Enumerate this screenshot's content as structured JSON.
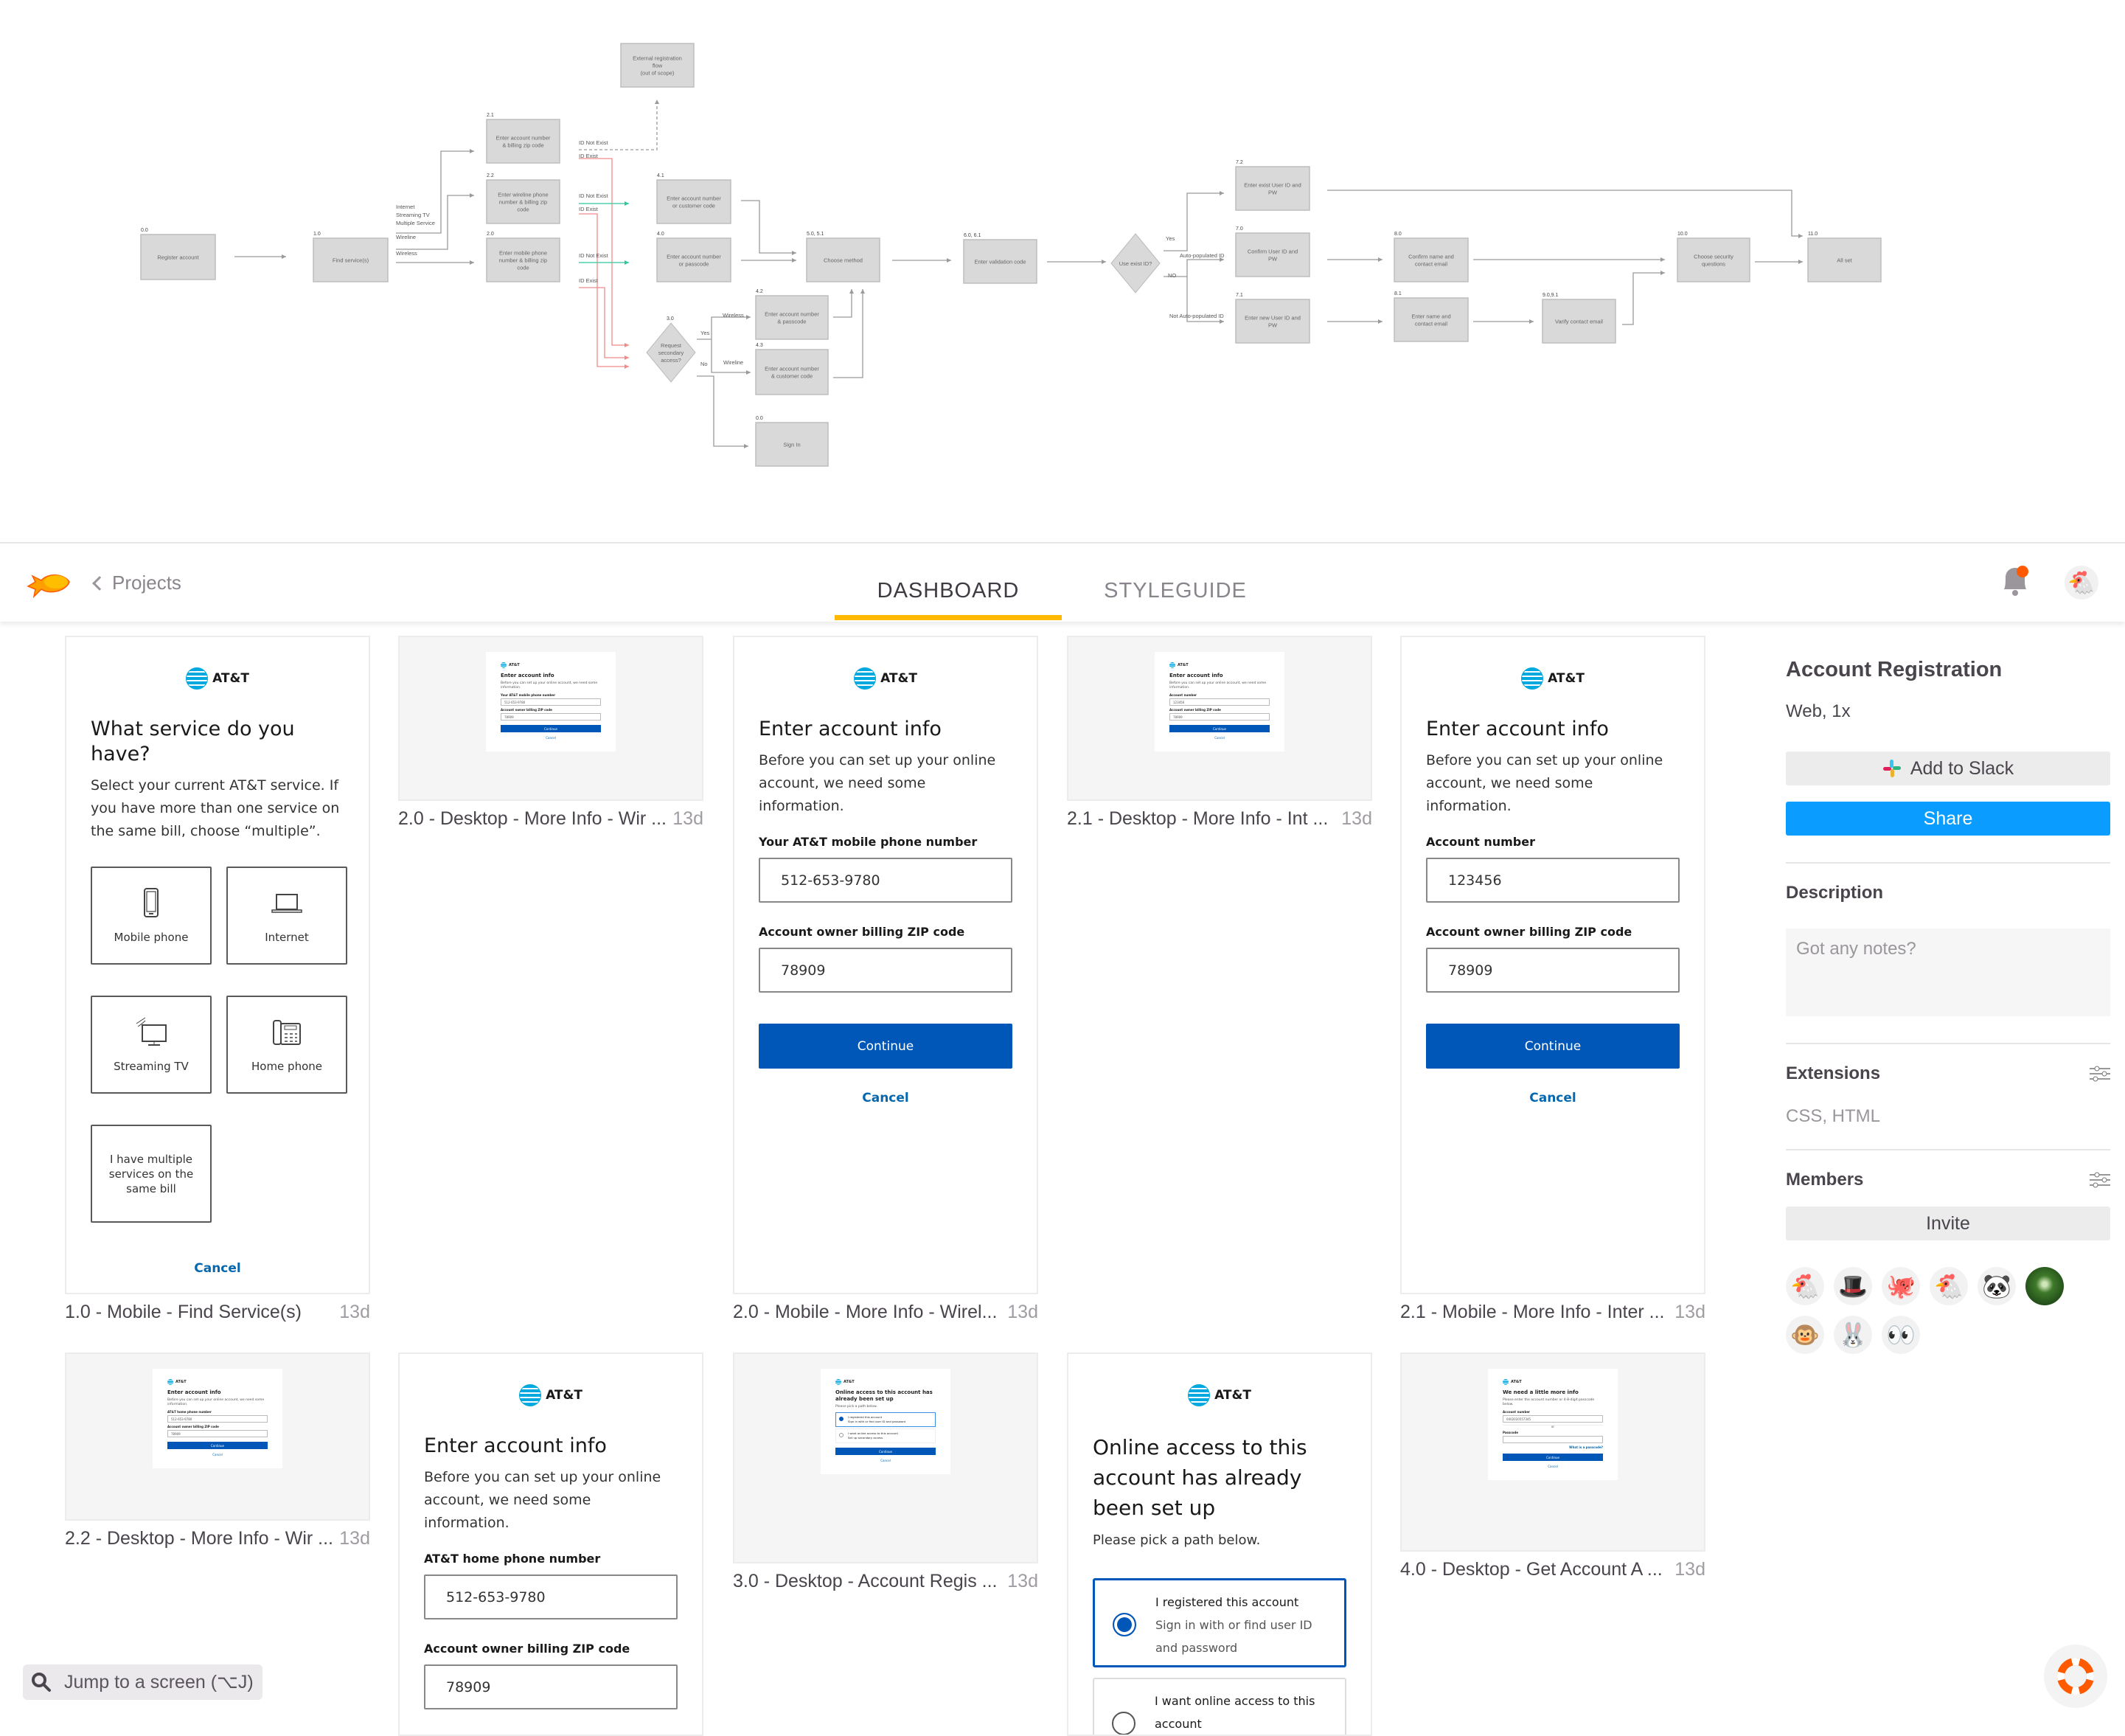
{
  "flow": {
    "nodes": [
      {
        "id": "0.0",
        "lines": [
          "Register account"
        ]
      },
      {
        "id": "1.0",
        "lines": [
          "Find service(s)"
        ]
      },
      {
        "id": "2.1",
        "lines": [
          "Enter account number",
          "& billing zip code"
        ]
      },
      {
        "id": "2.2",
        "lines": [
          "Enter wireline phone",
          "number & billing zip",
          "code"
        ]
      },
      {
        "id": "2.0",
        "lines": [
          "Enter mobile phone",
          "number & billing zip",
          "code"
        ]
      },
      {
        "id": "",
        "lines": [
          "External registration",
          "flow",
          "(out of scope)"
        ]
      },
      {
        "id": "4.1",
        "lines": [
          "Enter account number",
          "or customer code"
        ]
      },
      {
        "id": "4.0",
        "lines": [
          "Enter account number",
          "or passcode"
        ]
      },
      {
        "id": "5.0, 5.1",
        "lines": [
          "Choose method"
        ]
      },
      {
        "id": "4.2",
        "lines": [
          "Enter account number",
          "& passcode"
        ]
      },
      {
        "id": "4.3",
        "lines": [
          "Enter account number",
          "& customer code"
        ]
      },
      {
        "id": "0.0",
        "lines": [
          "Sign In"
        ]
      },
      {
        "id": "3.0",
        "lines": [
          "Request",
          "secondary",
          "access?"
        ]
      },
      {
        "id": "6.0, 6.1",
        "lines": [
          "Enter validation code"
        ]
      },
      {
        "id": "",
        "lines": [
          "Use exist ID?"
        ]
      },
      {
        "id": "7.2",
        "lines": [
          "Enter exist User ID and",
          "PW"
        ]
      },
      {
        "id": "7.0",
        "lines": [
          "Confirm User ID and",
          "PW"
        ]
      },
      {
        "id": "7.1",
        "lines": [
          "Enter new User ID and",
          "PW"
        ]
      },
      {
        "id": "8.0",
        "lines": [
          "Confirm name and",
          "contact email"
        ]
      },
      {
        "id": "8.1",
        "lines": [
          "Enter name and",
          "contact email"
        ]
      },
      {
        "id": "9.0,9.1",
        "lines": [
          "Varify contact email"
        ]
      },
      {
        "id": "10.0",
        "lines": [
          "Choose security",
          "questions"
        ]
      },
      {
        "id": "11.0",
        "lines": [
          "All set"
        ]
      }
    ],
    "edge_labels": [
      "Internet",
      "Streaming TV",
      "Multiple Service",
      "Wireline",
      "Wireless",
      "ID Not Exist",
      "ID Exist",
      "ID Not Exist",
      "ID Exist",
      "ID Not Exist",
      "ID Exist",
      "Yes",
      "No",
      "Wireless",
      "Wireline",
      "Yes",
      "Auto-populated ID",
      "NO",
      "Not Auto-populated ID"
    ],
    "colors": {
      "line": "#9a9a9a",
      "exist": "#f08a8a",
      "not_exist": "#2fc79a",
      "node": "#d9d9d9"
    }
  },
  "header": {
    "back_label": "Projects",
    "tabs": [
      {
        "label": "DASHBOARD",
        "active": true
      },
      {
        "label": "STYLEGUIDE",
        "active": false
      }
    ],
    "accent": "#ffb900",
    "user_avatar": "🐔"
  },
  "brand": "AT&T",
  "cards": {
    "find_service": {
      "title": "What service do you have?",
      "body": "Select your current AT&T service. If you have more than one service on the same bill, choose “multiple”.",
      "tiles": [
        "Mobile phone",
        "Internet",
        "Streaming TV",
        "Home phone",
        "I have multiple services on the same bill"
      ],
      "cancel": "Cancel",
      "caption": "1.0 - Mobile - Find Service(s)",
      "age": "13d"
    },
    "mobile_wireless": {
      "title": "Enter account info",
      "body": "Before you can set up your online account, we need some information.",
      "field1_label": "Your AT&T mobile phone number",
      "field1_value": "512-653-9780",
      "field2_label": "Account owner billing ZIP code",
      "field2_value": "78909",
      "continue": "Continue",
      "cancel": "Cancel",
      "caption": "2.0 - Mobile - More Info - Wirel...",
      "age": "13d"
    },
    "mobile_internet": {
      "title": "Enter account info",
      "body": "Before you can set up your online account, we need some information.",
      "field1_label": "Account number",
      "field1_value": "123456",
      "field2_label": "Account owner billing ZIP code",
      "field2_value": "78909",
      "continue": "Continue",
      "cancel": "Cancel",
      "caption": "2.1 - Mobile - More Info - Inter ...",
      "age": "13d"
    },
    "mobile_wireline": {
      "title": "Enter account info",
      "body": "Before you can set up your online account, we need some information.",
      "field1_label": "AT&T home phone number",
      "field1_value": "512-653-9780",
      "field2_label": "Account owner billing ZIP code",
      "field2_value": "78909"
    },
    "mobile_online_access": {
      "title": "Online access to this account has already been set up",
      "body": "Please pick a path below.",
      "option1_title": "I registered this account",
      "option1_sub": "Sign in with or find user ID and password",
      "option2_title": "I want online access to this account"
    }
  },
  "thumbs": [
    {
      "caption": "2.0 - Desktop - More Info - Wir ...",
      "age": "13d",
      "items": [
        {
          "t": "title",
          "text": "Enter account info"
        },
        {
          "t": "p",
          "text": "Before you can set up your online account, we need some information."
        },
        {
          "t": "label",
          "text": "Your AT&T mobile phone number"
        },
        {
          "t": "input",
          "text": "512-653-9780"
        },
        {
          "t": "label",
          "text": "Account owner billing ZIP code"
        },
        {
          "t": "input",
          "text": "78909"
        },
        {
          "t": "button",
          "text": "Continue"
        },
        {
          "t": "cancel",
          "text": "Cancel"
        }
      ]
    },
    {
      "caption": "2.1 - Desktop - More Info - Int  ...",
      "age": "13d",
      "items": [
        {
          "t": "title",
          "text": "Enter account info"
        },
        {
          "t": "p",
          "text": "Before you can set up your online account, we need some information."
        },
        {
          "t": "label",
          "text": "Account number"
        },
        {
          "t": "input",
          "text": "123456"
        },
        {
          "t": "label",
          "text": "Account owner billing ZIP code"
        },
        {
          "t": "input",
          "text": "78909"
        },
        {
          "t": "button",
          "text": "Continue"
        },
        {
          "t": "cancel",
          "text": "Cancel"
        }
      ]
    },
    {
      "caption": "2.2 - Desktop - More Info - Wir ...",
      "age": "13d",
      "items": [
        {
          "t": "title",
          "text": "Enter account info"
        },
        {
          "t": "p",
          "text": "Before you can set up your online account, we need some information."
        },
        {
          "t": "label",
          "text": "AT&T home phone number"
        },
        {
          "t": "input",
          "text": "512-653-9780"
        },
        {
          "t": "label",
          "text": "Account owner billing ZIP code"
        },
        {
          "t": "input",
          "text": "78909"
        },
        {
          "t": "button",
          "text": "Continue"
        },
        {
          "t": "cancel",
          "text": "Cancel"
        }
      ]
    },
    {
      "caption": "3.0 - Desktop - Account Regis ...",
      "age": "13d",
      "items": [
        {
          "t": "title",
          "text": "Online access to this account has already been set up"
        },
        {
          "t": "p",
          "text": "Please pick a path below."
        },
        {
          "t": "radio",
          "selected": true,
          "text": "I registered this account",
          "sub": "Sign in with or find user ID and password"
        },
        {
          "t": "radio",
          "selected": false,
          "text": "I want online access to this account",
          "sub": "Set up secondary access"
        },
        {
          "t": "button",
          "text": "Continue"
        },
        {
          "t": "cancel",
          "text": "Cancel"
        }
      ]
    },
    {
      "caption": "4.0 - Desktop - Get Account A ...",
      "age": "13d",
      "items": [
        {
          "t": "title",
          "text": "We need a little more info"
        },
        {
          "t": "p",
          "text": "Please enter the account number or 4-8-digit passcode below."
        },
        {
          "t": "label",
          "text": "Account number"
        },
        {
          "t": "input",
          "text": "0402020557345"
        },
        {
          "t": "or",
          "text": "or"
        },
        {
          "t": "label",
          "text": "Passcode"
        },
        {
          "t": "input",
          "text": ""
        },
        {
          "t": "link",
          "text": "What is a passcode?"
        },
        {
          "t": "button",
          "text": "Continue"
        },
        {
          "t": "cancel",
          "text": "Cancel"
        }
      ]
    }
  ],
  "panel": {
    "title": "Account Registration",
    "subtitle": "Web, 1x",
    "slack_label": "Add to Slack",
    "share_label": "Share",
    "description_heading": "Description",
    "description_placeholder": "Got any notes?",
    "extensions_heading": "Extensions",
    "extensions_value": "CSS, HTML",
    "members_heading": "Members",
    "invite_label": "Invite",
    "members": [
      "🐔",
      "🎩",
      "🐙",
      "🐔",
      "🐼",
      "photo",
      "🐵",
      "🐰",
      "👀"
    ]
  },
  "footer": {
    "jump_label": "Jump to a screen (⌥J)"
  }
}
